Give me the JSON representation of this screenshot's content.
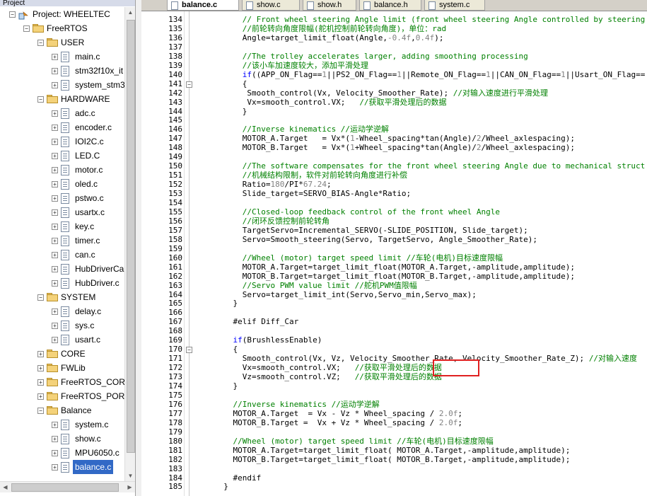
{
  "project_panel": {
    "title": "Project",
    "tree": [
      {
        "label": "Project: WHEELTEC",
        "kind": "target",
        "level": 0,
        "expander": "−"
      },
      {
        "label": "FreeRTOS",
        "kind": "folder",
        "level": 1,
        "expander": "−"
      },
      {
        "label": "USER",
        "kind": "folder",
        "level": 2,
        "expander": "−"
      },
      {
        "label": "main.c",
        "kind": "file",
        "level": 3,
        "expander": "+"
      },
      {
        "label": "stm32f10x_it",
        "kind": "file",
        "level": 3,
        "expander": "+"
      },
      {
        "label": "system_stm3",
        "kind": "file",
        "level": 3,
        "expander": "+"
      },
      {
        "label": "HARDWARE",
        "kind": "folder",
        "level": 2,
        "expander": "−"
      },
      {
        "label": "adc.c",
        "kind": "file",
        "level": 3,
        "expander": "+"
      },
      {
        "label": "encoder.c",
        "kind": "file",
        "level": 3,
        "expander": "+"
      },
      {
        "label": "IOI2C.c",
        "kind": "file",
        "level": 3,
        "expander": "+"
      },
      {
        "label": "LED.C",
        "kind": "file",
        "level": 3,
        "expander": "+"
      },
      {
        "label": "motor.c",
        "kind": "file",
        "level": 3,
        "expander": "+"
      },
      {
        "label": "oled.c",
        "kind": "file",
        "level": 3,
        "expander": "+"
      },
      {
        "label": "pstwo.c",
        "kind": "file",
        "level": 3,
        "expander": "+"
      },
      {
        "label": "usartx.c",
        "kind": "file",
        "level": 3,
        "expander": "+"
      },
      {
        "label": "key.c",
        "kind": "file",
        "level": 3,
        "expander": "+"
      },
      {
        "label": "timer.c",
        "kind": "file",
        "level": 3,
        "expander": "+"
      },
      {
        "label": "can.c",
        "kind": "file",
        "level": 3,
        "expander": "+"
      },
      {
        "label": "HubDriverCa",
        "kind": "file",
        "level": 3,
        "expander": "+"
      },
      {
        "label": "HubDriver.c",
        "kind": "file",
        "level": 3,
        "expander": "+"
      },
      {
        "label": "SYSTEM",
        "kind": "folder",
        "level": 2,
        "expander": "−"
      },
      {
        "label": "delay.c",
        "kind": "file",
        "level": 3,
        "expander": "+"
      },
      {
        "label": "sys.c",
        "kind": "file",
        "level": 3,
        "expander": "+"
      },
      {
        "label": "usart.c",
        "kind": "file",
        "level": 3,
        "expander": "+"
      },
      {
        "label": "CORE",
        "kind": "folder",
        "level": 2,
        "expander": "+"
      },
      {
        "label": "FWLib",
        "kind": "folder",
        "level": 2,
        "expander": "+"
      },
      {
        "label": "FreeRTOS_CORE",
        "kind": "folder",
        "level": 2,
        "expander": "+"
      },
      {
        "label": "FreeRTOS_PORTA",
        "kind": "folder",
        "level": 2,
        "expander": "+"
      },
      {
        "label": "Balance",
        "kind": "folder",
        "level": 2,
        "expander": "−"
      },
      {
        "label": "system.c",
        "kind": "file",
        "level": 3,
        "expander": "+"
      },
      {
        "label": "show.c",
        "kind": "file",
        "level": 3,
        "expander": "+"
      },
      {
        "label": "MPU6050.c",
        "kind": "file",
        "level": 3,
        "expander": "+"
      },
      {
        "label": "balance.c",
        "kind": "file",
        "level": 3,
        "expander": "+",
        "selected": true
      }
    ]
  },
  "tabs": [
    {
      "label": "balance.c",
      "active": true
    },
    {
      "label": "show.c",
      "active": false
    },
    {
      "label": "show.h",
      "active": false
    },
    {
      "label": "balance.h",
      "active": false
    },
    {
      "label": "system.c",
      "active": false
    }
  ],
  "editor": {
    "lines": [
      {
        "n": "134",
        "fold": "",
        "segs": [
          [
            "cmt",
            "      // Front wheel steering Angle limit (front wheel steering Angle controlled by steering"
          ]
        ]
      },
      {
        "n": "135",
        "fold": "",
        "segs": [
          [
            "cmt",
            "      //前轮转向角度限幅(舵机控制前轮转向角度)，单位：rad"
          ]
        ]
      },
      {
        "n": "136",
        "fold": "",
        "segs": [
          [
            "",
            "      Angle=target_limit_float(Angle,"
          ],
          [
            "num",
            "-0.4f"
          ],
          [
            "",
            ","
          ],
          [
            "num",
            "0.4f"
          ],
          [
            "",
            ");"
          ]
        ]
      },
      {
        "n": "137",
        "fold": "",
        "segs": [
          [
            "",
            ""
          ]
        ]
      },
      {
        "n": "138",
        "fold": "",
        "segs": [
          [
            "cmt",
            "      //The trolley accelerates larger, adding smoothing processing"
          ]
        ]
      },
      {
        "n": "139",
        "fold": "",
        "segs": [
          [
            "cmt",
            "      //该小车加速度较大，添加平滑处理"
          ]
        ]
      },
      {
        "n": "140",
        "fold": "",
        "segs": [
          [
            "kw",
            "      if"
          ],
          [
            "",
            "((APP_ON_Flag=="
          ],
          [
            "num",
            "1"
          ],
          [
            "",
            "||PS2_ON_Flag=="
          ],
          [
            "num",
            "1"
          ],
          [
            "",
            "||Remote_ON_Flag=="
          ],
          [
            "num",
            "1"
          ],
          [
            "",
            "||CAN_ON_Flag=="
          ],
          [
            "num",
            "1"
          ],
          [
            "",
            "||Usart_ON_Flag=="
          ]
        ]
      },
      {
        "n": "141",
        "fold": "−",
        "segs": [
          [
            "",
            "      {"
          ]
        ]
      },
      {
        "n": "142",
        "fold": "",
        "segs": [
          [
            "",
            "       Smooth_control(Vx, Velocity_Smoother_Rate); "
          ],
          [
            "cmt",
            "//对输入速度进行平滑处理"
          ]
        ]
      },
      {
        "n": "143",
        "fold": "",
        "segs": [
          [
            "",
            "       Vx=smooth_control.VX;   "
          ],
          [
            "cmt",
            "//获取平滑处理后的数据"
          ]
        ]
      },
      {
        "n": "144",
        "fold": "",
        "segs": [
          [
            "",
            "      }"
          ]
        ]
      },
      {
        "n": "145",
        "fold": "",
        "segs": [
          [
            "",
            ""
          ]
        ]
      },
      {
        "n": "146",
        "fold": "",
        "segs": [
          [
            "cmt",
            "      //Inverse kinematics //运动学逆解"
          ]
        ]
      },
      {
        "n": "147",
        "fold": "",
        "segs": [
          [
            "",
            "      MOTOR_A.Target   = Vx*("
          ],
          [
            "num",
            "1"
          ],
          [
            "",
            "-Wheel_spacing*tan(Angle)/"
          ],
          [
            "num",
            "2"
          ],
          [
            "",
            "/Wheel_axlespacing);"
          ]
        ]
      },
      {
        "n": "148",
        "fold": "",
        "segs": [
          [
            "",
            "      MOTOR_B.Target   = Vx*("
          ],
          [
            "num",
            "1"
          ],
          [
            "",
            "+Wheel_spacing*tan(Angle)/"
          ],
          [
            "num",
            "2"
          ],
          [
            "",
            "/Wheel_axlespacing);"
          ]
        ]
      },
      {
        "n": "149",
        "fold": "",
        "segs": [
          [
            "",
            ""
          ]
        ]
      },
      {
        "n": "150",
        "fold": "",
        "segs": [
          [
            "cmt",
            "      //The software compensates for the front wheel steering Angle due to mechanical struct"
          ]
        ]
      },
      {
        "n": "151",
        "fold": "",
        "segs": [
          [
            "cmt",
            "      //机械结构限制，软件对前轮转向角度进行补偿"
          ]
        ]
      },
      {
        "n": "152",
        "fold": "",
        "segs": [
          [
            "",
            "      Ratio="
          ],
          [
            "num",
            "180"
          ],
          [
            "",
            "/PI*"
          ],
          [
            "num",
            "67.24"
          ],
          [
            "",
            ";"
          ]
        ]
      },
      {
        "n": "153",
        "fold": "",
        "segs": [
          [
            "",
            "      Slide_target=SERVO_BIAS-Angle*Ratio;"
          ]
        ]
      },
      {
        "n": "154",
        "fold": "",
        "segs": [
          [
            "",
            ""
          ]
        ]
      },
      {
        "n": "155",
        "fold": "",
        "segs": [
          [
            "cmt",
            "      //Closed-loop feedback control of the front wheel Angle"
          ]
        ]
      },
      {
        "n": "156",
        "fold": "",
        "segs": [
          [
            "cmt",
            "      //闭环反馈控制前轮转角"
          ]
        ]
      },
      {
        "n": "157",
        "fold": "",
        "segs": [
          [
            "",
            "      TargetServo=Incremental_SERVO(-SLIDE_POSITION, Slide_target);"
          ]
        ]
      },
      {
        "n": "158",
        "fold": "",
        "segs": [
          [
            "",
            "      Servo=Smooth_steering(Servo, TargetServo, Angle_Smoother_Rate);"
          ]
        ]
      },
      {
        "n": "159",
        "fold": "",
        "segs": [
          [
            "",
            ""
          ]
        ]
      },
      {
        "n": "160",
        "fold": "",
        "segs": [
          [
            "cmt",
            "      //Wheel (motor) target speed limit //车轮(电机)目标速度限幅"
          ]
        ]
      },
      {
        "n": "161",
        "fold": "",
        "segs": [
          [
            "",
            "      MOTOR_A.Target=target_limit_float(MOTOR_A.Target,-amplitude,amplitude);"
          ]
        ]
      },
      {
        "n": "162",
        "fold": "",
        "segs": [
          [
            "",
            "      MOTOR_B.Target=target_limit_float(MOTOR_B.Target,-amplitude,amplitude);"
          ]
        ]
      },
      {
        "n": "163",
        "fold": "",
        "segs": [
          [
            "cmt",
            "      //Servo PWM value limit //舵机PWM值限幅"
          ]
        ]
      },
      {
        "n": "164",
        "fold": "",
        "segs": [
          [
            "",
            "      Servo=target_limit_int(Servo,Servo_min,Servo_max);"
          ]
        ]
      },
      {
        "n": "165",
        "fold": "",
        "segs": [
          [
            "",
            "    }"
          ]
        ]
      },
      {
        "n": "166",
        "fold": "",
        "segs": [
          [
            "",
            ""
          ]
        ]
      },
      {
        "n": "167",
        "fold": "",
        "segs": [
          [
            "",
            "    #elif Diff_Car"
          ]
        ]
      },
      {
        "n": "168",
        "fold": "",
        "segs": [
          [
            "",
            ""
          ]
        ]
      },
      {
        "n": "169",
        "fold": "",
        "segs": [
          [
            "kw",
            "    if"
          ],
          [
            "",
            "(BrushlessEnable)"
          ]
        ]
      },
      {
        "n": "170",
        "fold": "−",
        "segs": [
          [
            "",
            "    {"
          ]
        ]
      },
      {
        "n": "171",
        "fold": "",
        "segs": [
          [
            "",
            "      Smooth_control(Vx, Vz, Velocity_Smoother_Rate, Velocity_Smoother_Rate_Z); "
          ],
          [
            "cmt",
            "//对输入速度"
          ]
        ]
      },
      {
        "n": "172",
        "fold": "",
        "segs": [
          [
            "",
            "      Vx=smooth_control.VX;   "
          ],
          [
            "cmt",
            "//获取平滑处理后的数据"
          ]
        ]
      },
      {
        "n": "173",
        "fold": "",
        "segs": [
          [
            "",
            "      Vz=smooth_control.VZ;   "
          ],
          [
            "cmt",
            "//获取平滑处理后的数据"
          ]
        ]
      },
      {
        "n": "174",
        "fold": "",
        "segs": [
          [
            "",
            "    }"
          ]
        ]
      },
      {
        "n": "175",
        "fold": "",
        "segs": [
          [
            "",
            ""
          ]
        ]
      },
      {
        "n": "176",
        "fold": "",
        "segs": [
          [
            "cmt",
            "    //Inverse kinematics //运动学逆解"
          ]
        ]
      },
      {
        "n": "177",
        "fold": "",
        "segs": [
          [
            "",
            "    MOTOR_A.Target  = Vx - Vz * Wheel_spacing / "
          ],
          [
            "num",
            "2.0f"
          ],
          [
            "",
            ";"
          ]
        ]
      },
      {
        "n": "178",
        "fold": "",
        "segs": [
          [
            "",
            "    MOTOR_B.Target =  Vx + Vz * Wheel_spacing / "
          ],
          [
            "num",
            "2.0f"
          ],
          [
            "",
            ";"
          ]
        ]
      },
      {
        "n": "179",
        "fold": "",
        "segs": [
          [
            "",
            ""
          ]
        ]
      },
      {
        "n": "180",
        "fold": "",
        "segs": [
          [
            "cmt",
            "    //Wheel (motor) target speed limit //车轮(电机)目标速度限幅"
          ]
        ]
      },
      {
        "n": "181",
        "fold": "",
        "segs": [
          [
            "",
            "    MOTOR_A.Target=target_limit_float( MOTOR_A.Target,-amplitude,amplitude);"
          ]
        ]
      },
      {
        "n": "182",
        "fold": "",
        "segs": [
          [
            "",
            "    MOTOR_B.Target=target_limit_float( MOTOR_B.Target,-amplitude,amplitude);"
          ]
        ]
      },
      {
        "n": "183",
        "fold": "",
        "segs": [
          [
            "",
            ""
          ]
        ]
      },
      {
        "n": "184",
        "fold": "",
        "segs": [
          [
            "",
            "    #endif"
          ]
        ]
      },
      {
        "n": "185",
        "fold": "",
        "segs": [
          [
            "",
            "  }"
          ]
        ]
      }
    ]
  },
  "colors": {
    "comment": "#008000",
    "keyword": "#0000ff",
    "number": "#808080",
    "selection": "#3169c6",
    "highlight_box": "#e02020"
  }
}
